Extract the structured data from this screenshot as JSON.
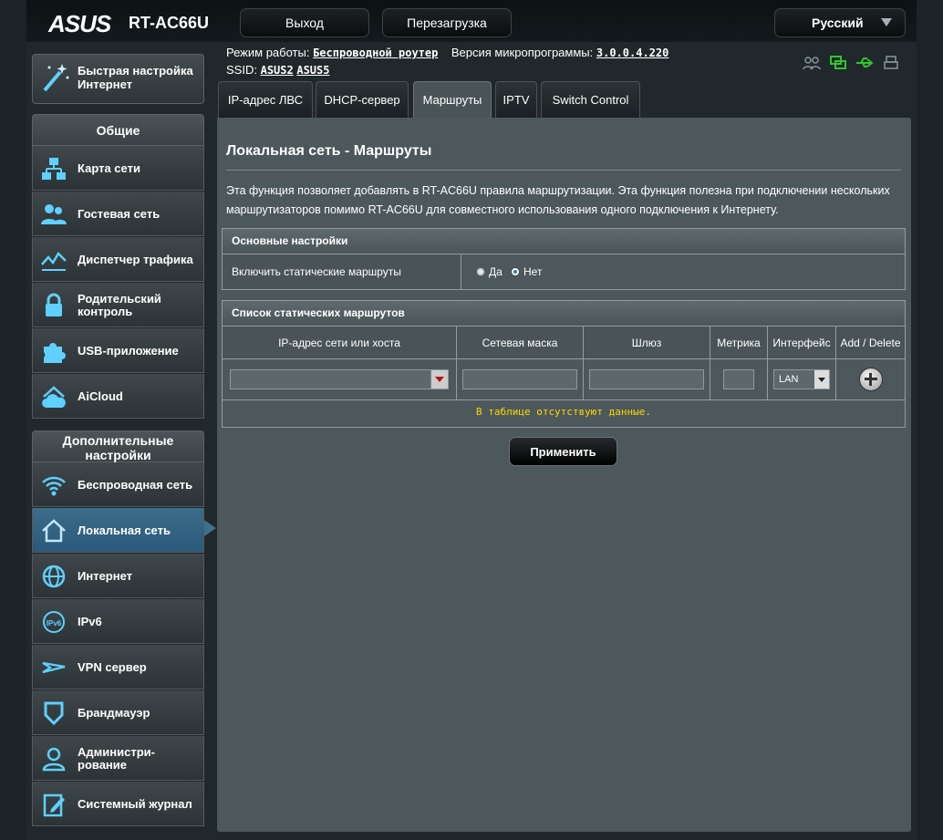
{
  "header": {
    "logo": "ASUS",
    "model": "RT-AC66U",
    "logout_label": "Выход",
    "reboot_label": "Перезагрузка",
    "language": "Русский"
  },
  "info": {
    "mode_label": "Режим работы:",
    "mode_value": "Беспроводной роутер",
    "fw_label": "Версия микропрограммы:",
    "fw_value": "3.0.0.4.220",
    "ssid_label": "SSID:",
    "ssid_1": "ASUS2",
    "ssid_2": "ASUS5"
  },
  "status_icons": [
    "clients-icon",
    "network-icon",
    "usb-icon",
    "printer-icon"
  ],
  "sidebar": {
    "quick_setup": "Быстрая настройка Интернет",
    "general_title": "Общие",
    "general": [
      {
        "label": "Карта сети",
        "icon": "network-map-icon"
      },
      {
        "label": "Гостевая сеть",
        "icon": "guest-network-icon"
      },
      {
        "label": "Диспетчер трафика",
        "icon": "traffic-manager-icon"
      },
      {
        "label": "Родительский контроль",
        "icon": "parental-control-icon"
      },
      {
        "label": "USB-приложение",
        "icon": "usb-app-icon"
      },
      {
        "label": "AiCloud",
        "icon": "aicloud-icon"
      }
    ],
    "advanced_title": "Дополнительные настройки",
    "advanced": [
      {
        "label": "Беспроводная сеть",
        "icon": "wireless-icon"
      },
      {
        "label": "Локальная сеть",
        "icon": "lan-icon",
        "active": true
      },
      {
        "label": "Интернет",
        "icon": "internet-icon"
      },
      {
        "label": "IPv6",
        "icon": "ipv6-icon"
      },
      {
        "label": "VPN сервер",
        "icon": "vpn-icon"
      },
      {
        "label": "Брандмауэр",
        "icon": "firewall-icon"
      },
      {
        "label": "Администри-рование",
        "icon": "administration-icon"
      },
      {
        "label": "Системный журнал",
        "icon": "system-log-icon"
      }
    ]
  },
  "tabs": [
    {
      "label": "IP-адрес ЛВС"
    },
    {
      "label": "DHCP-сервер"
    },
    {
      "label": "Маршруты",
      "active": true
    },
    {
      "label": "IPTV"
    },
    {
      "label": "Switch Control"
    }
  ],
  "main": {
    "title": "Локальная сеть - Маршруты",
    "description": "Эта функция позволяет добавлять в RT-AC66U правила маршрутизации. Эта функция полезна при подключении нескольких маршрутизаторов помимо RT-AC66U для совместного использования одного подключения к Интернету.",
    "basic_header": "Основные настройки",
    "static_label": "Включить статические маршруты",
    "yes": "Да",
    "no": "Нет",
    "static_enabled": false,
    "list_header": "Список статических маршрутов",
    "columns": [
      "IP-адрес сети или хоста",
      "Сетевая маска",
      "Шлюз",
      "Метрика",
      "Интерфейс",
      "Add / Delete"
    ],
    "interface_value": "LAN",
    "empty": "В таблице отсутствуют данные.",
    "apply": "Применить"
  }
}
